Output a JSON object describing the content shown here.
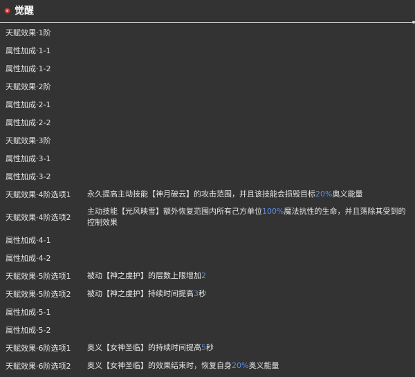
{
  "header": {
    "title": "觉醒",
    "icon": "red-dot-icon"
  },
  "colors": {
    "background": "#333333",
    "text": "#e6e6e6",
    "highlight": "#5b8fe6",
    "icon": "#d63d3d"
  },
  "rows": [
    {
      "label": "天赋效果·1阶",
      "desc": []
    },
    {
      "label": "属性加成·1-1",
      "desc": []
    },
    {
      "label": "属性加成·1-2",
      "desc": []
    },
    {
      "label": "天赋效果·2阶",
      "desc": []
    },
    {
      "label": "属性加成·2-1",
      "desc": []
    },
    {
      "label": "属性加成·2-2",
      "desc": []
    },
    {
      "label": "天赋效果·3阶",
      "desc": []
    },
    {
      "label": "属性加成·3-1",
      "desc": []
    },
    {
      "label": "属性加成·3-2",
      "desc": []
    },
    {
      "label": "天赋效果·4阶选项1",
      "desc": [
        {
          "text": "永久提高主动技能【神月破云】的攻击范围，并且该技能会损毁目标"
        },
        {
          "text": "20%",
          "hl": true
        },
        {
          "text": "奥义能量"
        }
      ]
    },
    {
      "label": "天赋效果·4阶选项2",
      "tall": true,
      "desc": [
        {
          "text": "主动技能【光风映雪】额外恢复范围内所有己方单位"
        },
        {
          "text": "100%",
          "hl": true
        },
        {
          "text": "魔法抗性的生命，并且荡除其受到的控制效果"
        }
      ]
    },
    {
      "label": "属性加成·4-1",
      "desc": []
    },
    {
      "label": "属性加成·4-2",
      "desc": []
    },
    {
      "label": "天赋效果·5阶选项1",
      "desc": [
        {
          "text": "被动【神之虔护】的层数上限增加"
        },
        {
          "text": "2",
          "hl": true
        }
      ]
    },
    {
      "label": "天赋效果·5阶选项2",
      "desc": [
        {
          "text": "被动【神之虔护】持续时间提高"
        },
        {
          "text": "3",
          "hl": true
        },
        {
          "text": "秒"
        }
      ]
    },
    {
      "label": "属性加成·5-1",
      "desc": []
    },
    {
      "label": "属性加成·5-2",
      "desc": []
    },
    {
      "label": "天赋效果·6阶选项1",
      "desc": [
        {
          "text": "奥义【女神圣临】的持续时间提高"
        },
        {
          "text": "5",
          "hl": true
        },
        {
          "text": "秒"
        }
      ]
    },
    {
      "label": "天赋效果·6阶选项2",
      "desc": [
        {
          "text": "奥义【女神圣临】的效果结束时，恢复自身"
        },
        {
          "text": "20%",
          "hl": true
        },
        {
          "text": "奥义能量"
        }
      ]
    }
  ]
}
